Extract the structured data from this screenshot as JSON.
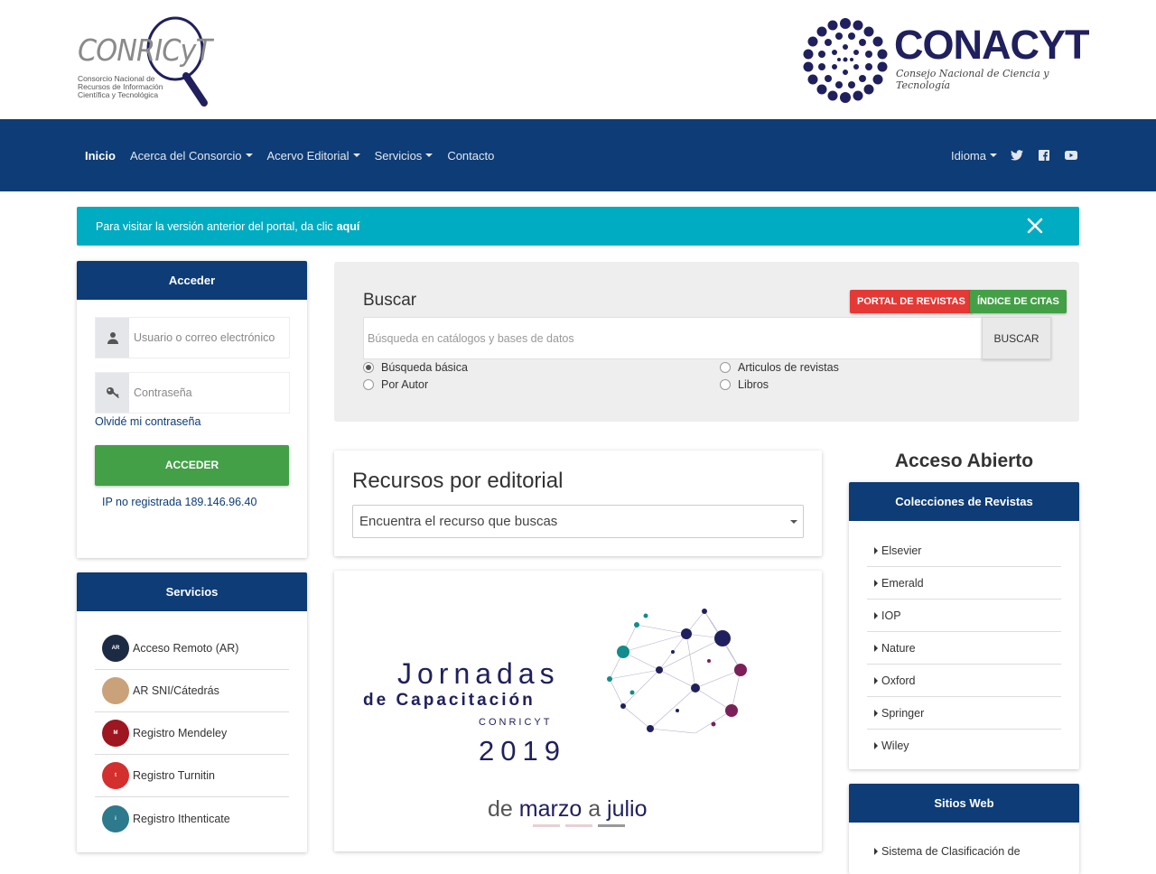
{
  "header": {
    "conricyt_wordmark": "CONRICyT",
    "conricyt_subtitle": "Consorcio Nacional de Recursos de Información Científica y Tecnológica",
    "conacyt_name": "CONACYT",
    "conacyt_tagline": "Consejo Nacional de Ciencia y Tecnología",
    "brand_color": "#0d3c76",
    "conacyt_color": "#20205e"
  },
  "nav": {
    "items": [
      {
        "label": "Inicio",
        "dropdown": false,
        "active": true
      },
      {
        "label": "Acerca del Consorcio",
        "dropdown": true
      },
      {
        "label": "Acervo Editorial",
        "dropdown": true
      },
      {
        "label": "Servicios",
        "dropdown": true
      },
      {
        "label": "Contacto",
        "dropdown": false
      }
    ],
    "language": "Idioma",
    "social": [
      "twitter-icon",
      "facebook-icon",
      "youtube-icon"
    ]
  },
  "alert": {
    "text": "Para visitar la versión anterior del portal, da clic",
    "link": "aquí",
    "color": "#00acc1"
  },
  "login": {
    "title": "Acceder",
    "username_placeholder": "Usuario o correo electrónico",
    "password_placeholder": "Contraseña",
    "forgot": "Olvidé mi contraseña",
    "button": "ACCEDER",
    "ip_text": "IP no registrada 189.146.96.40"
  },
  "services": {
    "title": "Servicios",
    "items": [
      {
        "label": "Acceso Remoto (AR)",
        "icon": "remote-access-icon",
        "color": "#1d2a44"
      },
      {
        "label": "AR SNI/Cátedrás",
        "icon": "sni-catedras-icon",
        "color": "#c9a27a"
      },
      {
        "label": "Registro Mendeley",
        "icon": "mendeley-icon",
        "color": "#9d1620"
      },
      {
        "label": "Registro Turnitin",
        "icon": "turnitin-icon",
        "color": "#d32f2f"
      },
      {
        "label": "Registro Ithenticate",
        "icon": "ithenticate-icon",
        "color": "#2c7a8c"
      }
    ]
  },
  "search": {
    "title": "Buscar",
    "portal_button": "PORTAL DE REVISTAS",
    "citas_button": "ÍNDICE DE CITAS",
    "placeholder": "Búsqueda en catálogos y bases de datos",
    "button": "BUSCAR",
    "options": [
      {
        "label": "Búsqueda básica",
        "checked": true
      },
      {
        "label": "Por Autor",
        "checked": false
      },
      {
        "label": "Articulos de revistas",
        "checked": false
      },
      {
        "label": "Libros",
        "checked": false
      }
    ]
  },
  "recursos": {
    "title": "Recursos por editorial",
    "select_value": "Encuentra el recurso que buscas"
  },
  "banner": {
    "line1": "Jornadas",
    "line2": "de Capacitación",
    "line3": "CONRICYT",
    "line4": "2019",
    "line5_a": "de",
    "line5_b": "marzo",
    "line5_c": "a",
    "line5_d": "julio"
  },
  "acceso_abierto": {
    "title": "Acceso Abierto",
    "colecciones_title": "Colecciones de Revistas",
    "colecciones": [
      "Elsevier",
      "Emerald",
      "IOP",
      "Nature",
      "Oxford",
      "Springer",
      "Wiley"
    ],
    "sitios_title": "Sitios Web",
    "sitios_first": "Sistema de Clasificación de"
  }
}
